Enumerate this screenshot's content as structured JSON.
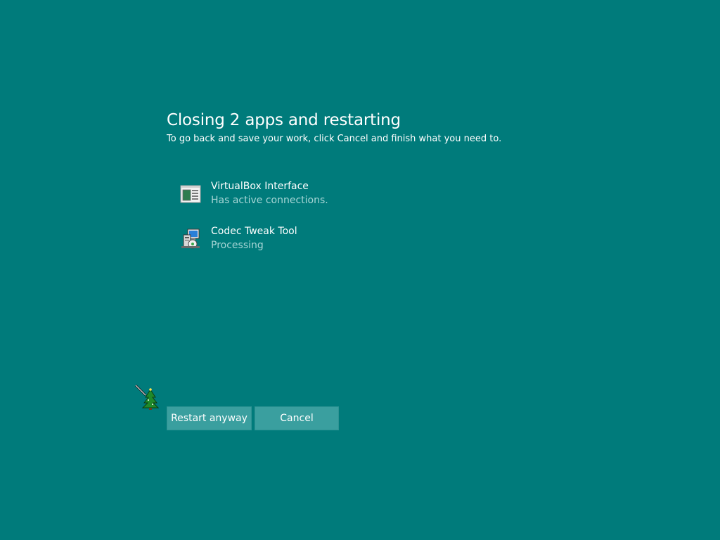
{
  "dialog": {
    "title": "Closing 2 apps and restarting",
    "subtitle": "To go back and save your work, click Cancel and finish what you need to."
  },
  "apps": [
    {
      "name": "VirtualBox Interface",
      "status": "Has active connections.",
      "icon": "window-app-icon"
    },
    {
      "name": "Codec Tweak Tool",
      "status": "Processing",
      "icon": "installer-computer-icon"
    }
  ],
  "buttons": {
    "restart_label": "Restart anyway",
    "cancel_label": "Cancel"
  },
  "colors": {
    "background": "#007b7b",
    "button": "#3a9f9f",
    "status_text": "#a7d6d6"
  },
  "cursor": {
    "icon": "christmas-tree-cursor-icon"
  }
}
